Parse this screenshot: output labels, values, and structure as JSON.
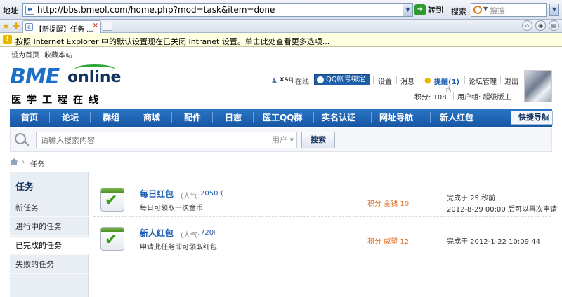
{
  "browser": {
    "address_label": "地址",
    "url": "http://bbs.bmeol.com/home.php?mod=task&item=done",
    "go_label": "转到",
    "search_label": "搜索",
    "search_placeholder": "搜搜",
    "tab_title": "【新提醒】任务 ...",
    "info_bar": "按照 Internet Explorer 中的默认设置现在已关闭 Intranet 设置。单击此处查看更多选项..."
  },
  "top_links": [
    "设为首页",
    "收藏本站"
  ],
  "logo": {
    "brand": "BME",
    "online": "online",
    "subtitle": "医学工程在线"
  },
  "user": {
    "name": "xsq",
    "status": "在线",
    "qq_bind": "QQ帐号绑定",
    "settings": "设置",
    "messages": "消息",
    "reminders": "提醒(1)",
    "forum_admin": "论坛管理",
    "logout": "退出",
    "points": "积分: 108",
    "group": "用户组: 超级版主"
  },
  "nav": {
    "items": [
      "首页",
      "论坛",
      "群组",
      "商城",
      "配件",
      "日志",
      "医工QQ群",
      "实名认证",
      "网址导航",
      "新人红包"
    ],
    "quick_nav": "快捷导航"
  },
  "search": {
    "placeholder": "请输入搜索内容",
    "type": "用户",
    "button": "搜索"
  },
  "breadcrumb": {
    "current": "任务"
  },
  "sidebar": {
    "title": "任务",
    "items": [
      "新任务",
      "进行中的任务",
      "已完成的任务",
      "失败的任务"
    ],
    "active_index": 2
  },
  "tasks": [
    {
      "name": "每日红包",
      "popularity_label": "(人气:",
      "popularity": "20503",
      "popularity_end": ")",
      "desc": "每日可领取一次金币",
      "reward": "积分  金钱  10",
      "status_line1": "完成于  25 秒前",
      "status_line2": "2012-8-29 00:00 后可以再次申请"
    },
    {
      "name": "新人红包",
      "popularity_label": "(人气:",
      "popularity": "720",
      "popularity_end": ")",
      "desc": "申请此任务即可领取红包",
      "reward": "积分  威望  12",
      "status_line1": "完成于  2012-1-22 10:09:44",
      "status_line2": ""
    }
  ]
}
